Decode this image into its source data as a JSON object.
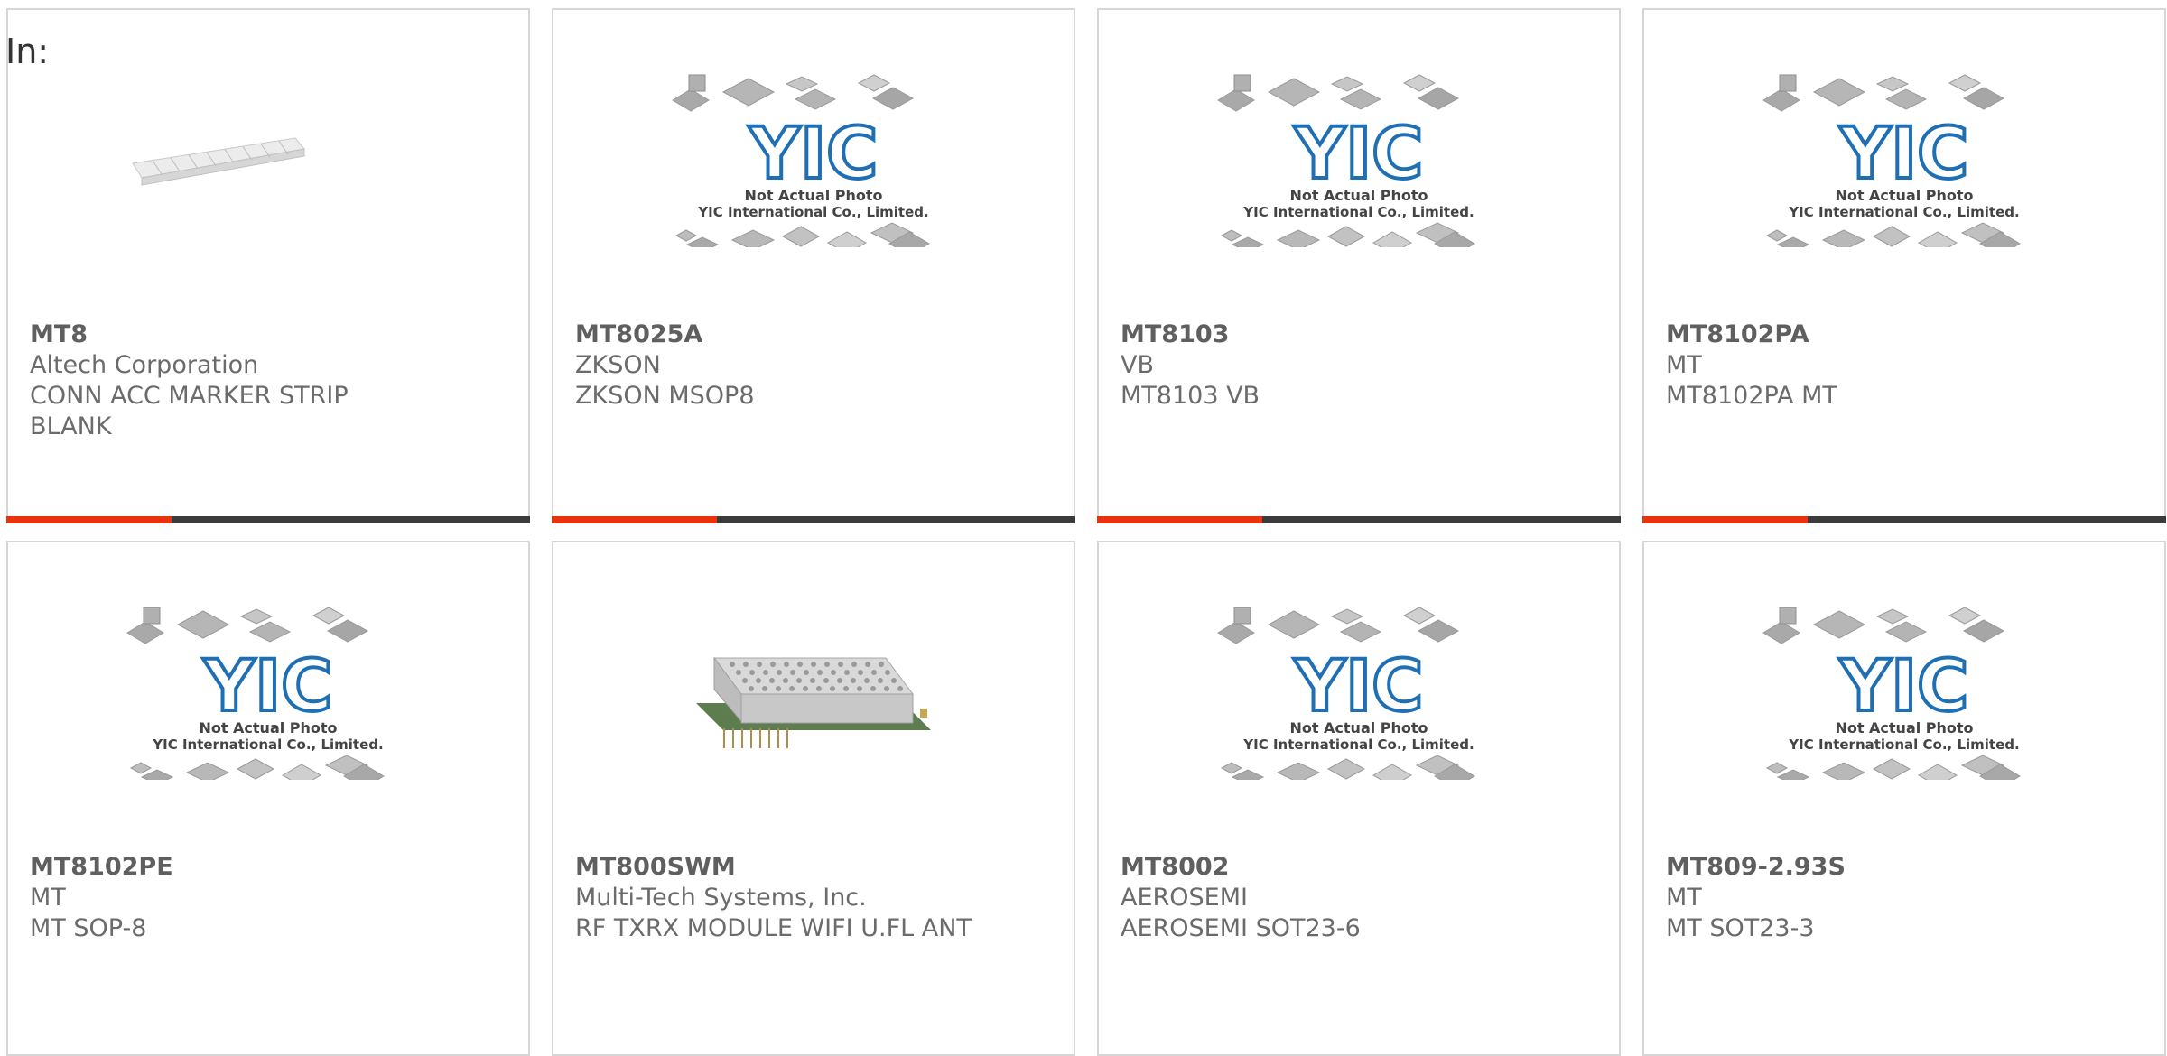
{
  "heading": "In:",
  "accent_color": "#e8340c",
  "bar_color": "#3b3b3b",
  "placeholder_image": {
    "line1": "Not Actual Photo",
    "line2": "YIC International Co., Limited.",
    "logo": "YIC"
  },
  "products": [
    {
      "part": "MT8",
      "maker": "Altech Corporation",
      "desc": "CONN ACC MARKER STRIP",
      "desc2": "BLANK",
      "image": "marker-strip"
    },
    {
      "part": "MT8025A",
      "maker": "ZKSON",
      "desc": "ZKSON MSOP8",
      "desc2": "",
      "image": "placeholder"
    },
    {
      "part": "MT8103",
      "maker": "VB",
      "desc": "MT8103 VB",
      "desc2": "",
      "image": "placeholder"
    },
    {
      "part": "MT8102PA",
      "maker": "MT",
      "desc": "MT8102PA MT",
      "desc2": "",
      "image": "placeholder"
    },
    {
      "part": "MT8102PE",
      "maker": "MT",
      "desc": "MT SOP-8",
      "desc2": "",
      "image": "placeholder"
    },
    {
      "part": "MT800SWM",
      "maker": "Multi-Tech Systems, Inc.",
      "desc": "RF TXRX MODULE WIFI U.FL ANT",
      "desc2": "",
      "image": "wifi-module"
    },
    {
      "part": "MT8002",
      "maker": "AEROSEMI",
      "desc": "AEROSEMI SOT23-6",
      "desc2": "",
      "image": "placeholder"
    },
    {
      "part": "MT809-2.93S",
      "maker": "MT",
      "desc": "MT SOT23-3",
      "desc2": "",
      "image": "placeholder"
    }
  ]
}
